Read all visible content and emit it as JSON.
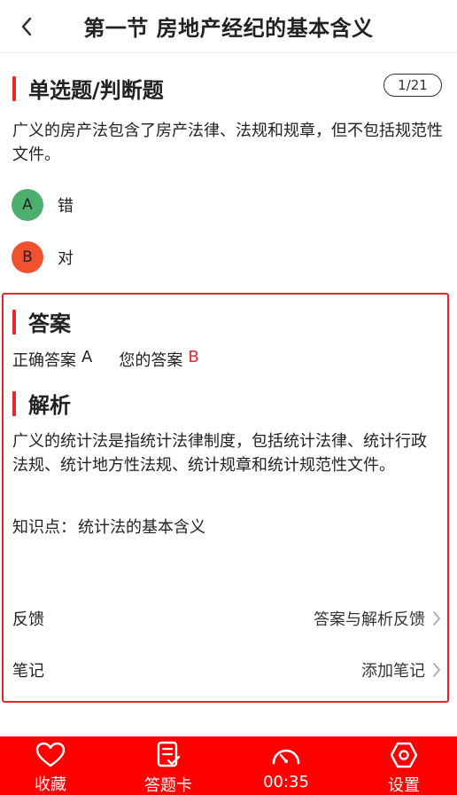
{
  "header": {
    "title": "第一节 房地产经纪的基本含义"
  },
  "question": {
    "type_label": "单选题/判断题",
    "counter": "1/21",
    "text": "广义的房产法包含了房产法律、法规和规章，但不包括规范性文件。",
    "options": [
      {
        "letter": "A",
        "label": "错",
        "color": "#4caf6e"
      },
      {
        "letter": "B",
        "label": "对",
        "color": "#f0522f"
      }
    ]
  },
  "answer": {
    "heading": "答案",
    "correct_label": "正确答案",
    "correct_value": "A",
    "yours_label": "您的答案",
    "yours_value": "B"
  },
  "analysis": {
    "heading": "解析",
    "text": "广义的统计法是指统计法律制度，包括统计法律、统计行政法规、统计地方性法规、统计规章和统计规范性文件。",
    "knowledge_label": "知识点：",
    "knowledge_value": "统计法的基本含义"
  },
  "feedback": {
    "label": "反馈",
    "action": "答案与解析反馈"
  },
  "notes": {
    "label": "笔记",
    "action": "添加笔记"
  },
  "tabbar": {
    "items": [
      {
        "label": "收藏",
        "icon": "heart-icon"
      },
      {
        "label": "答题卡",
        "icon": "answer-card-icon"
      },
      {
        "label": "00:35",
        "icon": "timer-icon"
      },
      {
        "label": "设置",
        "icon": "settings-icon"
      }
    ],
    "background": "#ff0000"
  },
  "colors": {
    "accent": "#e8262b"
  }
}
